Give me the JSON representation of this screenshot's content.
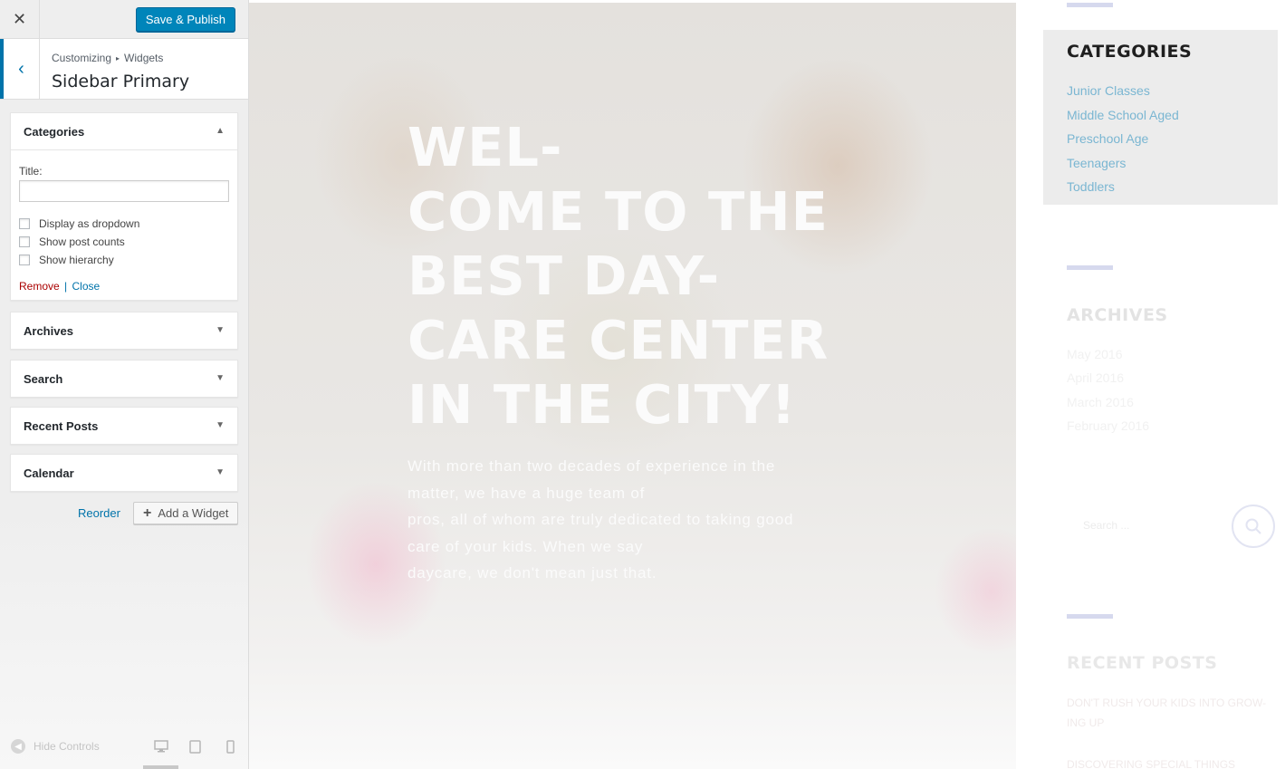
{
  "customizer": {
    "close_icon": "close-icon",
    "publish_label": "Save & Publish",
    "breadcrumb": {
      "root": "Customizing",
      "separator": "▸",
      "current": "Widgets"
    },
    "section_title": "Sidebar Primary",
    "widgets": [
      {
        "title": "Categories",
        "expanded": true,
        "title_field_label": "Title:",
        "title_field_value": "",
        "options": [
          {
            "label": "Display as dropdown",
            "checked": false
          },
          {
            "label": "Show post counts",
            "checked": false
          },
          {
            "label": "Show hierarchy",
            "checked": false
          }
        ],
        "remove_label": "Remove",
        "separator": "|",
        "close_label": "Close"
      },
      {
        "title": "Archives",
        "expanded": false
      },
      {
        "title": "Search",
        "expanded": false
      },
      {
        "title": "Recent Posts",
        "expanded": false
      },
      {
        "title": "Calendar",
        "expanded": false
      }
    ],
    "reorder_label": "Reorder",
    "add_widget_label": "Add a Widget",
    "footer": {
      "hide_controls_label": "Hide Controls",
      "devices": [
        "desktop",
        "tablet",
        "mobile"
      ],
      "selected_device": "desktop"
    }
  },
  "preview": {
    "hero": {
      "title": "WEL-\nCOME TO THE\nBEST DAY-\nCARE CENTER\nIN THE CITY!",
      "text": "With more than two decades of experience in the\nmatter, we have a huge team of\npros, all of whom are truly dedicated to taking good\ncare of your kids. When we say\ndaycare, we don't mean just that."
    },
    "sidebar": {
      "categories": {
        "title": "CATEGORIES",
        "items": [
          "Junior Classes",
          "Middle School Aged",
          "Preschool Age",
          "Teenagers",
          "Toddlers"
        ]
      },
      "archives": {
        "title": "ARCHIVES",
        "items": [
          "May 2016",
          "April 2016",
          "March 2016",
          "February 2016"
        ]
      },
      "search": {
        "placeholder": "Search ..."
      },
      "recent_posts": {
        "title": "RECENT POSTS",
        "items": [
          "DON'T RUSH YOUR KIDS INTO GROW-\nING UP",
          "DISCOVERING SPECIAL THINGS"
        ]
      }
    }
  },
  "colors": {
    "accent": "#0073aa",
    "publish": "#0085ba",
    "remove": "#aa0000",
    "category_link": "#7ab6d2"
  }
}
